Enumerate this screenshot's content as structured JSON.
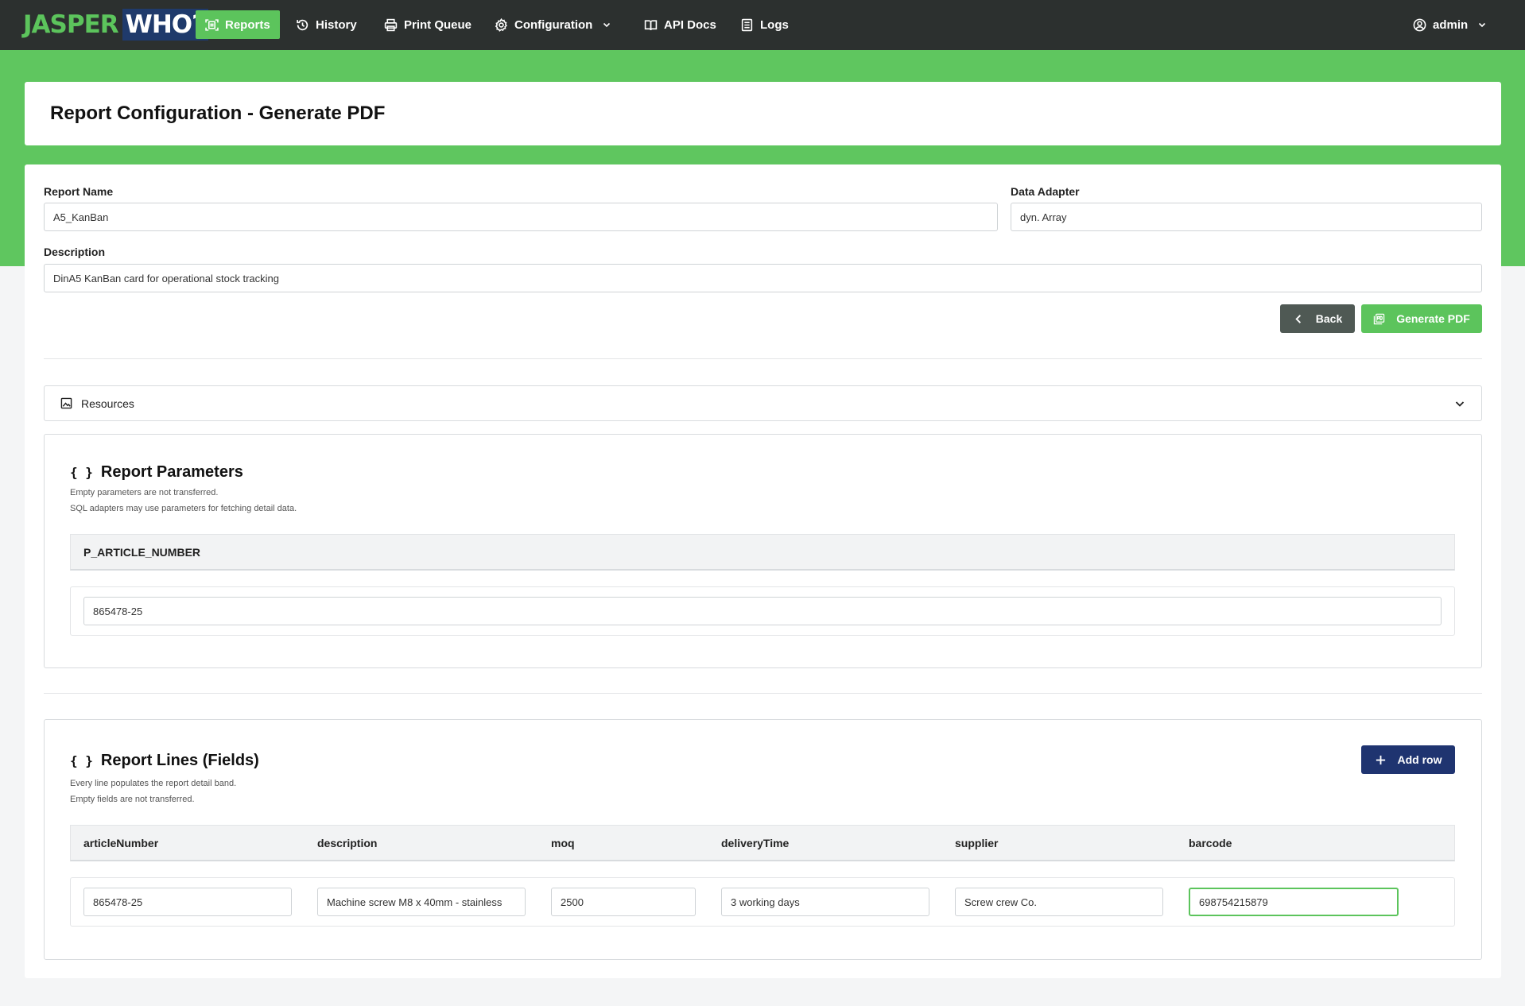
{
  "brand": {
    "part1": "JASPER",
    "part2": "WHO?"
  },
  "nav": {
    "reports": "Reports",
    "history": "History",
    "print_queue": "Print Queue",
    "configuration": "Configuration",
    "api_docs": "API Docs",
    "logs": "Logs",
    "user": "admin"
  },
  "page": {
    "title": "Report Configuration - Generate PDF"
  },
  "form": {
    "report_name_label": "Report Name",
    "report_name_value": "A5_KanBan",
    "data_adapter_label": "Data Adapter",
    "data_adapter_value": "dyn. Array",
    "description_label": "Description",
    "description_value": "DinA5 KanBan card for operational stock tracking"
  },
  "actions": {
    "back": "Back",
    "generate": "Generate PDF"
  },
  "resources": {
    "label": "Resources"
  },
  "parameters": {
    "title": "Report Parameters",
    "note1": "Empty parameters are not transferred.",
    "note2": "SQL adapters may use parameters for fetching detail data.",
    "header": "P_ARTICLE_NUMBER",
    "value": "865478-25"
  },
  "lines": {
    "title": "Report Lines (Fields)",
    "note1": "Every line populates the report detail band.",
    "note2": "Empty fields are not transferred.",
    "add_row": "Add row",
    "columns": [
      "articleNumber",
      "description",
      "moq",
      "deliveryTime",
      "supplier",
      "barcode"
    ],
    "rows": [
      [
        "865478-25",
        "Machine screw M8 x 40mm - stainless",
        "2500",
        "3 working days",
        "Screw crew Co.",
        "698754215879"
      ]
    ]
  },
  "colors": {
    "accent": "#5cc45c",
    "nav_bg": "#2c302f",
    "band": "#5fc65f",
    "add_button": "#1f3470",
    "back_button": "#4f5954"
  }
}
